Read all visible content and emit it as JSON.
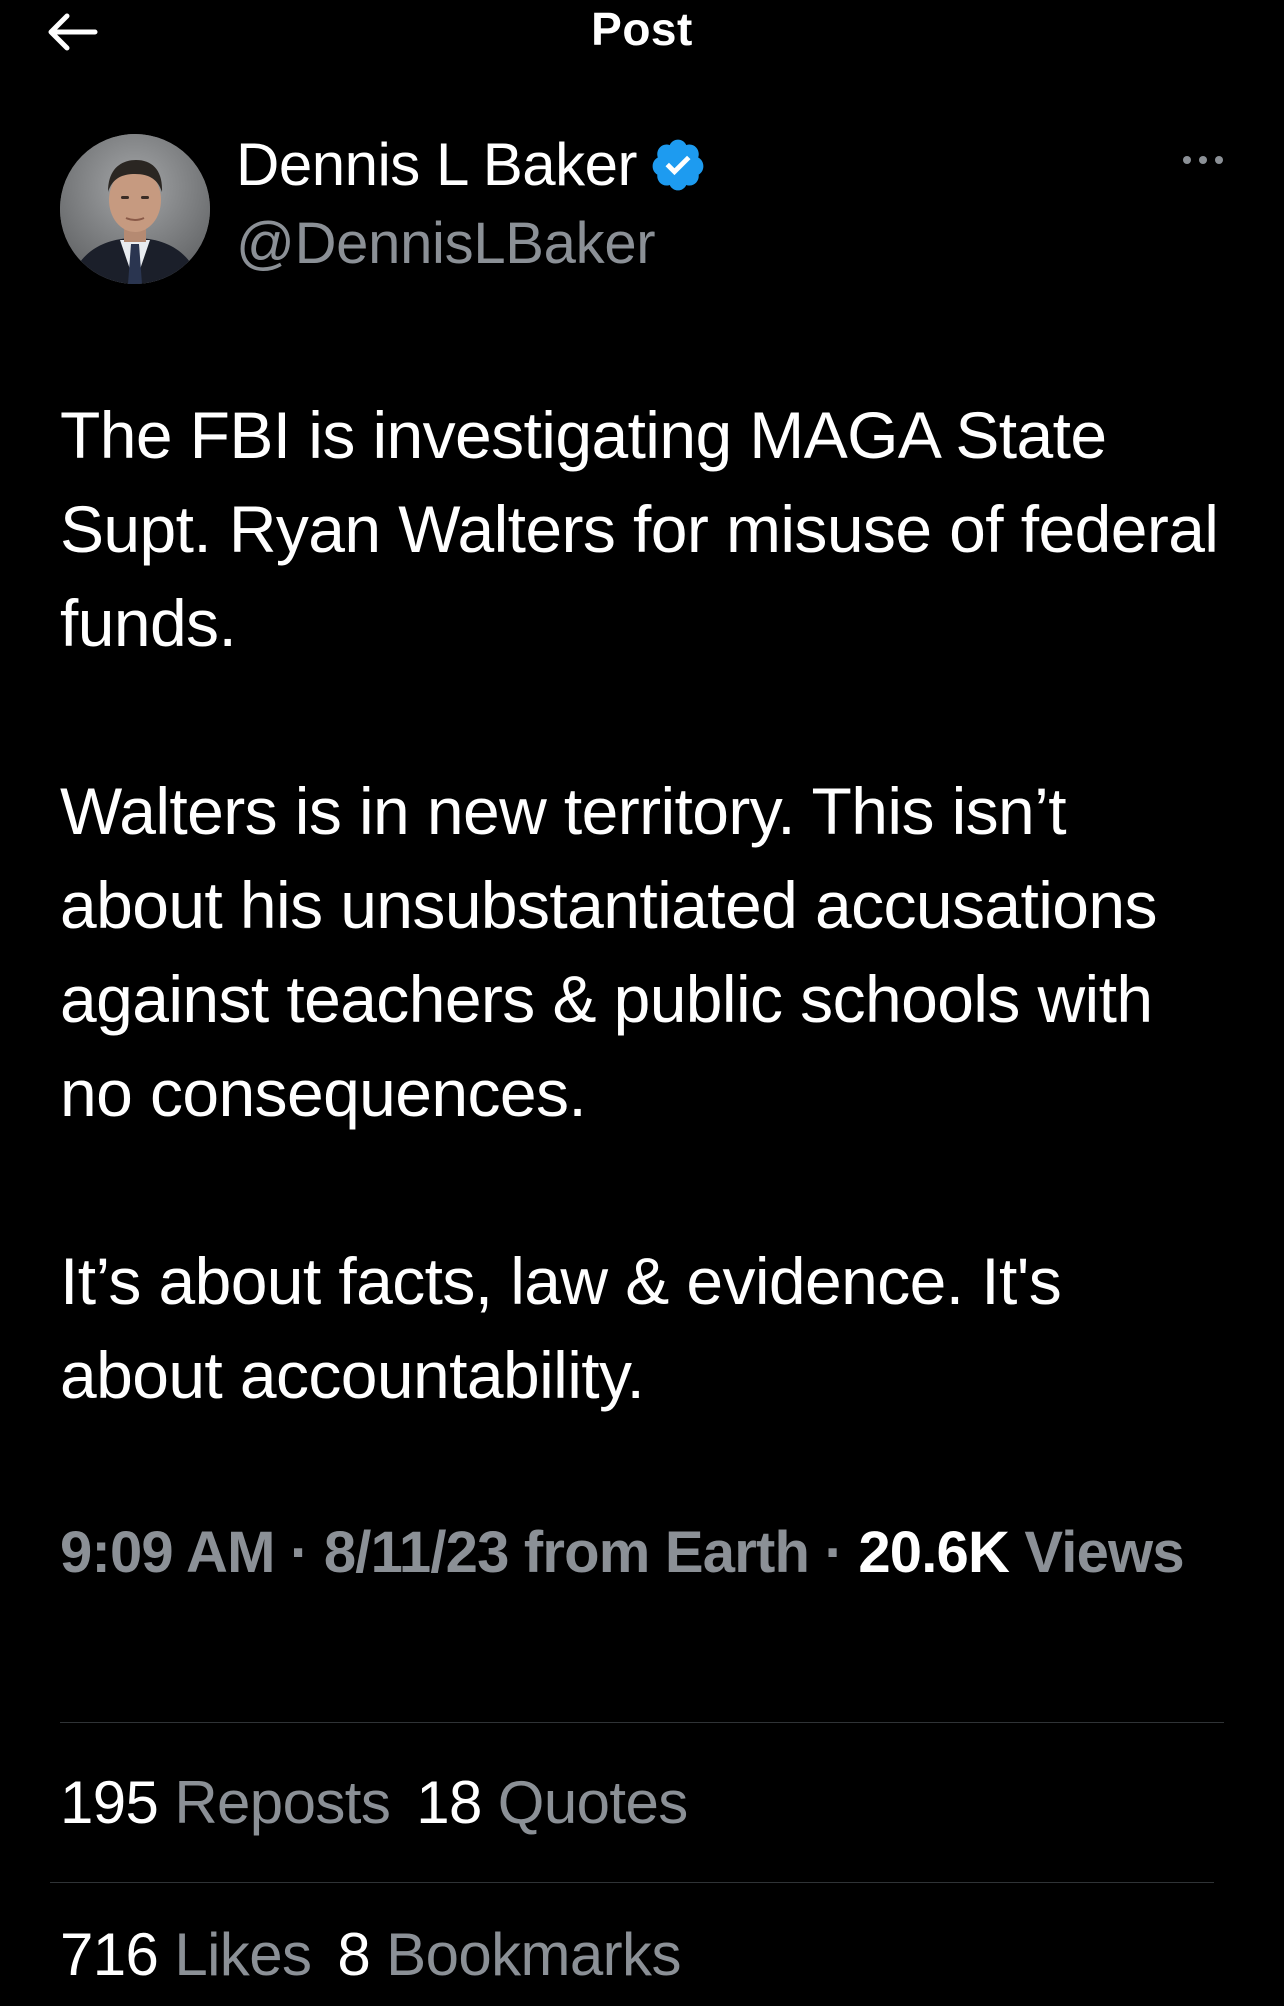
{
  "header": {
    "title": "Post",
    "back_icon": "arrow-left-icon"
  },
  "author": {
    "name": "Dennis L Baker",
    "handle": "@DennisLBaker",
    "verified_icon": "verified-badge-icon",
    "verified_color": "#1d9bf0",
    "more_icon": "more-horizontal-icon"
  },
  "post": {
    "paragraphs": [
      "The FBI is investigating MAGA State Supt. Ryan Walters for misuse of federal funds.",
      "Walters is in new territory. This isn’t about his unsubstantiated accusations against teachers & public schools with no consequences.",
      "It’s about facts, law & evidence. It's about accountability."
    ]
  },
  "meta": {
    "time": "9:09 AM",
    "separator": "·",
    "date": "8/11/23",
    "source": "from Earth",
    "views_count": "20.6K",
    "views_label": "Views"
  },
  "stats": {
    "reposts_count": "195",
    "reposts_label": "Reposts",
    "quotes_count": "18",
    "quotes_label": "Quotes",
    "likes_count": "716",
    "likes_label": "Likes",
    "bookmarks_count": "8",
    "bookmarks_label": "Bookmarks"
  },
  "colors": {
    "background": "#000000",
    "primary_text": "#ffffff",
    "secondary_text": "#8b9096",
    "divider": "#2f3336",
    "accent": "#1d9bf0"
  }
}
